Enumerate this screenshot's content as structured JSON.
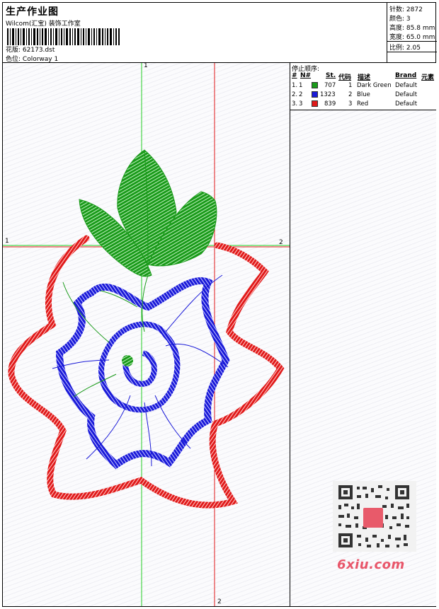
{
  "header": {
    "title": "生产作业图",
    "subtitle": "Wilcom(汇宝) 装饰工作室",
    "design_label": "花版:",
    "design_value": "62173.dst",
    "colorway_label": "色位:",
    "colorway_value": "Colorway 1"
  },
  "stats": [
    {
      "label": "针数:",
      "value": "2872"
    },
    {
      "label": "颜色:",
      "value": "3"
    },
    {
      "label": "高度:",
      "value": "85.8 mm"
    },
    {
      "label": "宽度:",
      "value": "65.0 mm"
    },
    {
      "label": "比例:",
      "value": "2.05"
    }
  ],
  "stop_sequence": {
    "title": "停止顺序:",
    "columns": [
      "#",
      "N#",
      "St.",
      "代码",
      "描述",
      "Brand",
      "元素"
    ],
    "rows": [
      {
        "idx": "1.",
        "n": "1",
        "color": "#1a9a1a",
        "st": "707",
        "code": "1",
        "desc": "Dark Green",
        "brand": "Default"
      },
      {
        "idx": "2.",
        "n": "2",
        "color": "#1a1ad8",
        "st": "1323",
        "code": "2",
        "desc": "Blue",
        "brand": "Default"
      },
      {
        "idx": "3.",
        "n": "3",
        "color": "#e01a1a",
        "st": "839",
        "code": "3",
        "desc": "Red",
        "brand": "Default"
      }
    ]
  },
  "axes": {
    "v_top": "1",
    "h_left": "1",
    "h_right": "2",
    "v_bottom": "2"
  },
  "thread_colors": {
    "green": "#1a9a1a",
    "blue": "#1a1ad8",
    "red": "#e01a1a"
  },
  "watermark": {
    "text": "6xiu.com"
  }
}
